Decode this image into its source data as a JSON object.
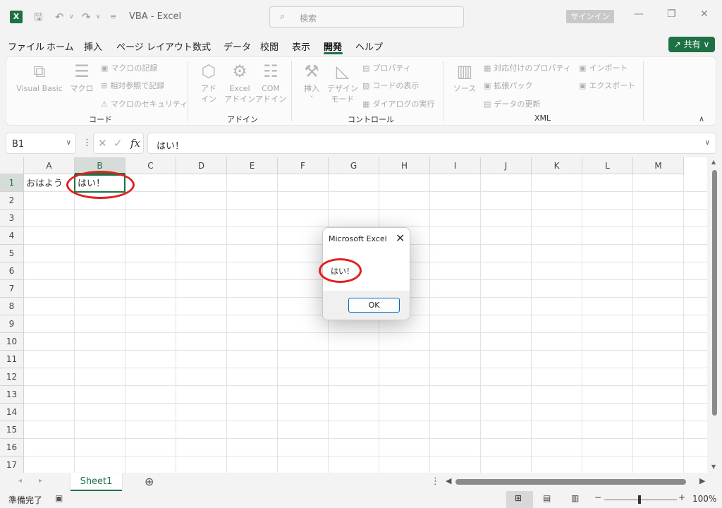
{
  "app": {
    "title": "VBA  -  Excel",
    "search_placeholder": "検索",
    "signin_label": "サインイン",
    "share_label": "共有",
    "logo": "X",
    "accent": "#1e7145"
  },
  "menu": {
    "tabs": [
      "ファイル",
      "ホーム",
      "挿入",
      "ページ レイアウト",
      "数式",
      "データ",
      "校閲",
      "表示",
      "開発",
      "ヘルプ"
    ],
    "active": "開発"
  },
  "ribbon": {
    "groups": {
      "code": "コード",
      "addins": "アドイン",
      "controls": "コントロール",
      "xml": "XML"
    },
    "code": {
      "visual_basic": "Visual Basic",
      "macro": "マクロ",
      "record_macro": "マクロの記録",
      "relative_ref": "相対参照で記録",
      "macro_security": "マクロのセキュリティ"
    },
    "addins": {
      "addin_l1": "アド",
      "addin_l2": "イン",
      "excel_l1": "Excel",
      "excel_l2": "アドイン",
      "com_l1": "COM",
      "com_l2": "アドイン"
    },
    "controls": {
      "insert": "挿入",
      "design_l1": "デザイン",
      "design_l2": "モード",
      "properties": "プロパティ",
      "view_code": "コードの表示",
      "run_dialog": "ダイアログの実行"
    },
    "xml": {
      "source": "ソース",
      "map_properties": "対応付けのプロパティ",
      "expansion_packs": "拡張パック",
      "refresh_data": "データの更新",
      "import": "インポート",
      "export": "エクスポート"
    }
  },
  "formula_bar": {
    "name_box": "B1",
    "fx": "fx",
    "value": "はい！"
  },
  "sheet": {
    "columns": [
      "A",
      "B",
      "C",
      "D",
      "E",
      "F",
      "G",
      "H",
      "I",
      "J",
      "K",
      "L",
      "M"
    ],
    "rows": [
      "1",
      "2",
      "3",
      "4",
      "5",
      "6",
      "7",
      "8",
      "9",
      "10",
      "11",
      "12",
      "13",
      "14",
      "15",
      "16",
      "17"
    ],
    "cells": {
      "A1": "おはよう",
      "B1": "はい！"
    },
    "selected_cell": "B1"
  },
  "dialog": {
    "title": "Microsoft Excel",
    "message": "はい！",
    "ok_label": "OK"
  },
  "sheet_tabs": [
    "Sheet1"
  ],
  "status": {
    "ready": "準備完了",
    "zoom": "100%"
  }
}
